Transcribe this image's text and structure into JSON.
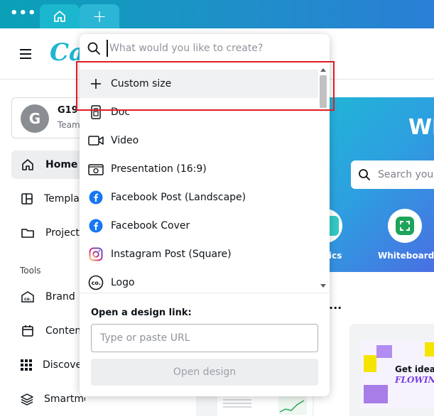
{
  "browser": {
    "menu_icon": "more-dots-icon",
    "home_tab_icon": "home-icon",
    "new_tab_label": "+"
  },
  "header": {
    "menu_icon": "hamburger-icon",
    "logo_text": "Ca"
  },
  "sidebar": {
    "team": {
      "avatar_letter": "G",
      "name": "G19",
      "subtitle": "Team"
    },
    "nav": [
      {
        "label": "Home",
        "icon": "home-icon",
        "active": true
      },
      {
        "label": "Templates",
        "icon": "templates-icon",
        "active": false
      },
      {
        "label": "Projects",
        "icon": "folder-icon",
        "active": false
      }
    ],
    "tools_label": "Tools",
    "tools": [
      {
        "label": "Brand",
        "icon": "brand-icon"
      },
      {
        "label": "Content",
        "icon": "calendar-icon"
      },
      {
        "label": "Discover",
        "icon": "apps-grid-icon"
      },
      {
        "label": "Smartmockups",
        "icon": "layers-icon"
      }
    ]
  },
  "main": {
    "hero_title": "Wh",
    "hero_search_placeholder": "Search your",
    "shortcuts": [
      {
        "label": "ics",
        "icon": "teal-shape-icon"
      },
      {
        "label": "Whiteboards",
        "icon": "whiteboard-icon"
      }
    ],
    "section_ellipsis": "...",
    "design_preview_text": [
      "Get idea",
      "FLOWING"
    ]
  },
  "dropdown": {
    "search_placeholder": "What would you like to create?",
    "search_value": "",
    "items": [
      {
        "label": "Custom size",
        "icon": "plus-icon",
        "highlighted": true
      },
      {
        "label": "Doc",
        "icon": "doc-icon",
        "highlighted": false
      },
      {
        "label": "Video",
        "icon": "video-icon",
        "highlighted": false
      },
      {
        "label": "Presentation (16:9)",
        "icon": "presentation-icon",
        "highlighted": false
      },
      {
        "label": "Facebook Post (Landscape)",
        "icon": "facebook-icon",
        "highlighted": false
      },
      {
        "label": "Facebook Cover",
        "icon": "facebook-icon",
        "highlighted": false
      },
      {
        "label": "Instagram Post (Square)",
        "icon": "instagram-icon",
        "highlighted": false
      },
      {
        "label": "Logo",
        "icon": "logo-co-icon",
        "highlighted": false
      }
    ],
    "link_label": "Open a design link:",
    "url_placeholder": "Type or paste URL",
    "url_value": "",
    "open_button_label": "Open design"
  },
  "colors": {
    "accent_teal": "#1fb5d3",
    "highlight_box": "#e11c24",
    "facebook_blue": "#1877f2"
  }
}
